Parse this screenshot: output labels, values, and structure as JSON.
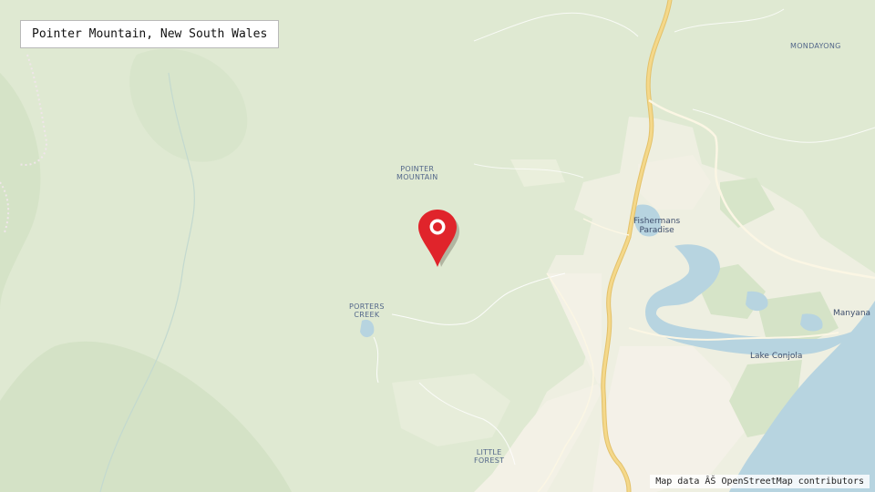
{
  "title": "Pointer Mountain, New South Wales",
  "attribution": "Map data ÂŠ OpenStreetMap contributors",
  "places": {
    "pointer_mountain": "POINTER\nMOUNTAIN",
    "porters_creek": "PORTERS\nCREEK",
    "little_forest": "LITTLE\nFOREST",
    "mondayong": "MONDAYONG",
    "fishermans_paradise": "Fishermans\nParadise",
    "lake_conjola": "Lake Conjola",
    "manyana": "Manyana"
  },
  "marker": {
    "icon": "map-pin-icon",
    "color": "#e0242b"
  },
  "colors": {
    "forest": "#dfe9d2",
    "forest_dark": "#d2e1c3",
    "cleared": "#f4f1e8",
    "water": "#b7d4e0",
    "road": "#f4d88a",
    "road_casing": "#e3c16a"
  }
}
